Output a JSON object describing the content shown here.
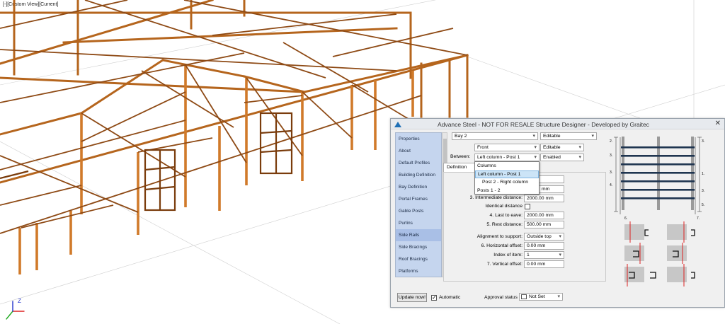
{
  "viewport": {
    "label": "[-][Custom View][Current]",
    "icon": "ucs-axes-icon",
    "axis_z": "Z"
  },
  "dialog": {
    "title": "Advance Steel - NOT FOR RESALE  Structure Designer - Developed by Graitec",
    "app_icon": "advance-steel-logo-icon",
    "close_label": "✕",
    "nav_items": [
      "Properties",
      "About",
      "Default Profiles",
      "Building Definition",
      "Bay Definition",
      "Portal Frames",
      "Gable Posts",
      "Purlins",
      "Side Rails",
      "Side Bracings",
      "Roof Bracings",
      "Platforms"
    ],
    "nav_selected": "Side Rails",
    "bay_select": "Bay 2",
    "bay_mode": "Editable",
    "side_select": "Front",
    "side_mode": "Editable",
    "between_label": "Between:",
    "between_select": "Left column - Post 1",
    "between_mode": "Enabled",
    "tab_label": "Definition",
    "dropdown_options": [
      "Columns",
      "Left column - Post 1",
      "Post 2 - Right column",
      "Posts 1 - 2"
    ],
    "dropdown_selected": "Left column - Post 1",
    "unit_mm": "mm",
    "intermediate_label": "3. Intermediate distance:",
    "intermediate_value": "2000.00 mm",
    "identical_label": "Identical distance",
    "last_to_eave_label": "4. Last to eave:",
    "last_to_eave_value": "2000.00 mm",
    "rest_label": "5. Rest distance:",
    "rest_value": "500.00 mm",
    "alignment_label": "Alignment to support:",
    "alignment_value": "Outside top",
    "h_offset_label": "6. Horizontal offset:",
    "h_offset_value": "0.00 mm",
    "index_label": "Index of item:",
    "index_value": "1",
    "v_offset_label": "7. Vertical offset:",
    "v_offset_value": "0.00 mm",
    "update_label": "Update now!",
    "automatic_label": "Automatic",
    "automatic_checked": true,
    "approval_label": "Approval status",
    "approval_value": "Not Set",
    "preview_labels": [
      "2.",
      "3.",
      "3.",
      "4.",
      "3.",
      "1.",
      "3.",
      "5.",
      "6.",
      "7."
    ]
  },
  "colors": {
    "steel": "#b5651d",
    "steel_dark": "#7a3c0c",
    "nav_bg": "#c5d5ee",
    "preview_rail": "#1f3550",
    "preview_post": "#9a9a9a"
  }
}
